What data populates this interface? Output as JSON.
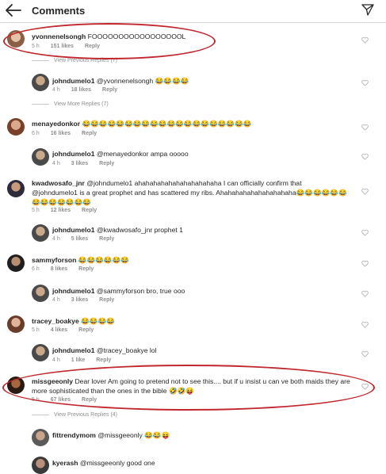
{
  "header": {
    "title": "Comments"
  },
  "comments": [
    {
      "user": "yvonnenelsongh",
      "text": "FOOOOOOOOOOOOOOOOOL",
      "time": "5 h",
      "likes": "151 likes",
      "reply": "Reply",
      "view_previous": "View Previous Replies (7)"
    },
    {
      "user": "johndumelo1",
      "text": "@yvonnenelsongh 😂😂😂😂",
      "time": "4 h",
      "likes": "18 likes",
      "reply": "Reply",
      "view_more": "View More Replies (7)"
    },
    {
      "user": "menayedonkor",
      "text": "😂😂😂😂😂😂😂😂😂😂😂😂😂😂😂😂😂😂😂😂",
      "time": "6 h",
      "likes": "16 likes",
      "reply": "Reply"
    },
    {
      "user": "johndumelo1",
      "text": "@menayedonkor ampa ooooo",
      "time": "4 h",
      "likes": "3 likes",
      "reply": "Reply"
    },
    {
      "user": "kwadwosafo_jnr",
      "text": "@johndumelo1 ahahahahahahahahahahaha I can officially confirm that @johndumelo1 is a great prophet and has scattered my ribs. Ahahahahahahahahahaha😂😂😂😂😂😂😂😂😂😂😂😂😂",
      "time": "5 h",
      "likes": "12 likes",
      "reply": "Reply"
    },
    {
      "user": "johndumelo1",
      "text": "@kwadwosafo_jnr prophet 1",
      "time": "4 h",
      "likes": "5 likes",
      "reply": "Reply"
    },
    {
      "user": "sammyforson",
      "text": "😂😂😂😂😂😂",
      "time": "6 h",
      "likes": "8 likes",
      "reply": "Reply"
    },
    {
      "user": "johndumelo1",
      "text": "@sammyforson bro, true ooo",
      "time": "4 h",
      "likes": "3 likes",
      "reply": "Reply"
    },
    {
      "user": "tracey_boakye",
      "text": "😂😂😂😂",
      "time": "5 h",
      "likes": "4 likes",
      "reply": "Reply"
    },
    {
      "user": "johndumelo1",
      "text": "@tracey_boakye lol",
      "time": "4 h",
      "likes": "1 like",
      "reply": "Reply"
    },
    {
      "user": "missgeeonly",
      "text": "Dear lover Am going to pretend not to see this.... but if u insist u can ve both maids they are more sophisticated than the ones in the bible 🤣🤣😝",
      "time": "5 h",
      "likes": "67 likes",
      "reply": "Reply",
      "view_previous": "View Previous Replies (4)"
    },
    {
      "user": "fittrendymom",
      "text": "@missgeeonly 😂😂😝",
      "time": "",
      "likes": "",
      "reply": ""
    },
    {
      "user": "kyerash",
      "text": "@missgeeonly good one",
      "time": "",
      "likes": "",
      "reply": ""
    }
  ],
  "colors": {
    "highlight_ring": "#c0282d",
    "meta_text": "#8e8e8e"
  },
  "icons": {
    "back": "arrow-left-icon",
    "send": "paper-plane-icon",
    "like": "heart-outline-icon"
  }
}
